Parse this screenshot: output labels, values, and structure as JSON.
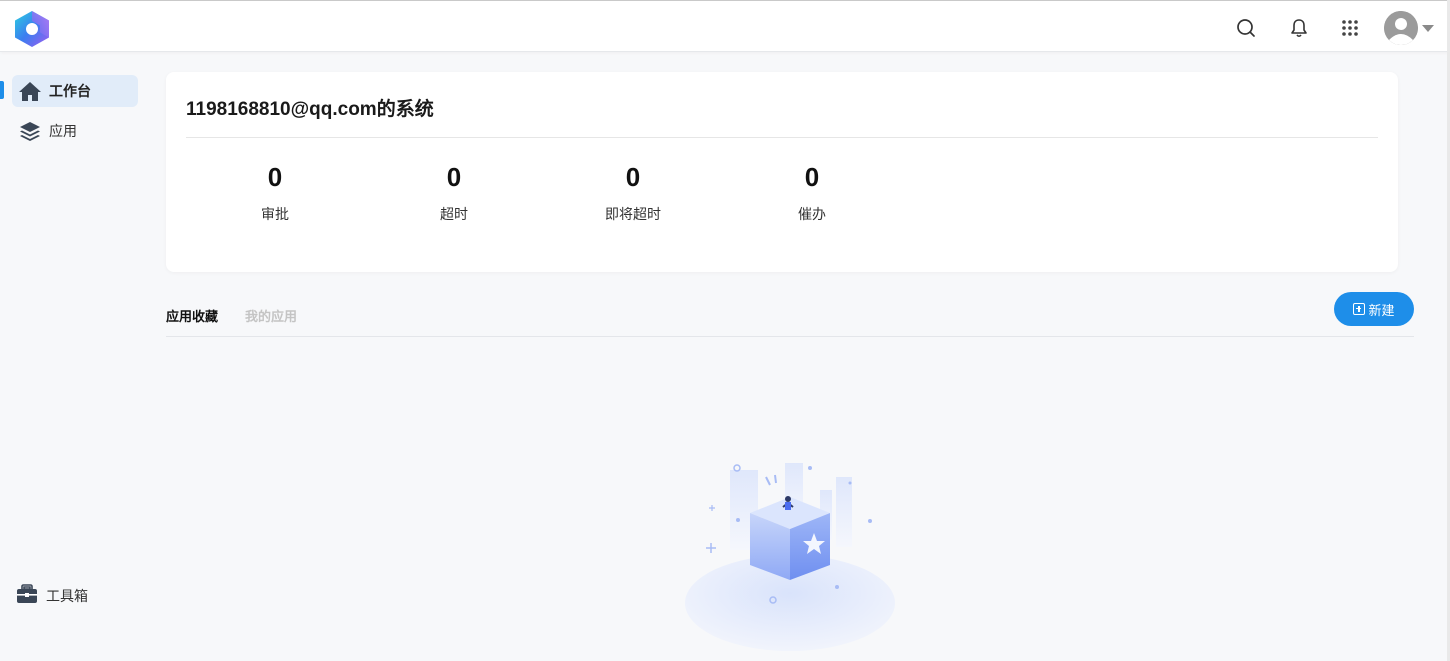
{
  "topbar": {
    "logo_icon": "app-logo",
    "icons": [
      "search-icon",
      "bell-icon",
      "apps-grid-icon",
      "user-avatar-icon"
    ]
  },
  "sidebar": {
    "items": [
      {
        "label": "工作台",
        "icon": "home-icon",
        "active": true
      },
      {
        "label": "应用",
        "icon": "layers-icon",
        "active": false
      }
    ],
    "toolbox_label": "工具箱",
    "toolbox_icon": "toolbox-icon"
  },
  "card": {
    "title": "1198168810@qq.com的系统",
    "stats": [
      {
        "value": "0",
        "label": "审批"
      },
      {
        "value": "0",
        "label": "超时"
      },
      {
        "value": "0",
        "label": "即将超时"
      },
      {
        "value": "0",
        "label": "催办"
      }
    ]
  },
  "tabs": [
    {
      "label": "应用收藏",
      "active": true
    },
    {
      "label": "我的应用",
      "active": false
    }
  ],
  "new_button": {
    "label": "新建",
    "icon": "plus-square-icon"
  },
  "colors": {
    "accent": "#1e8ee9",
    "active_bg": "#e1ecf9",
    "page_bg": "#f7f8fa"
  }
}
